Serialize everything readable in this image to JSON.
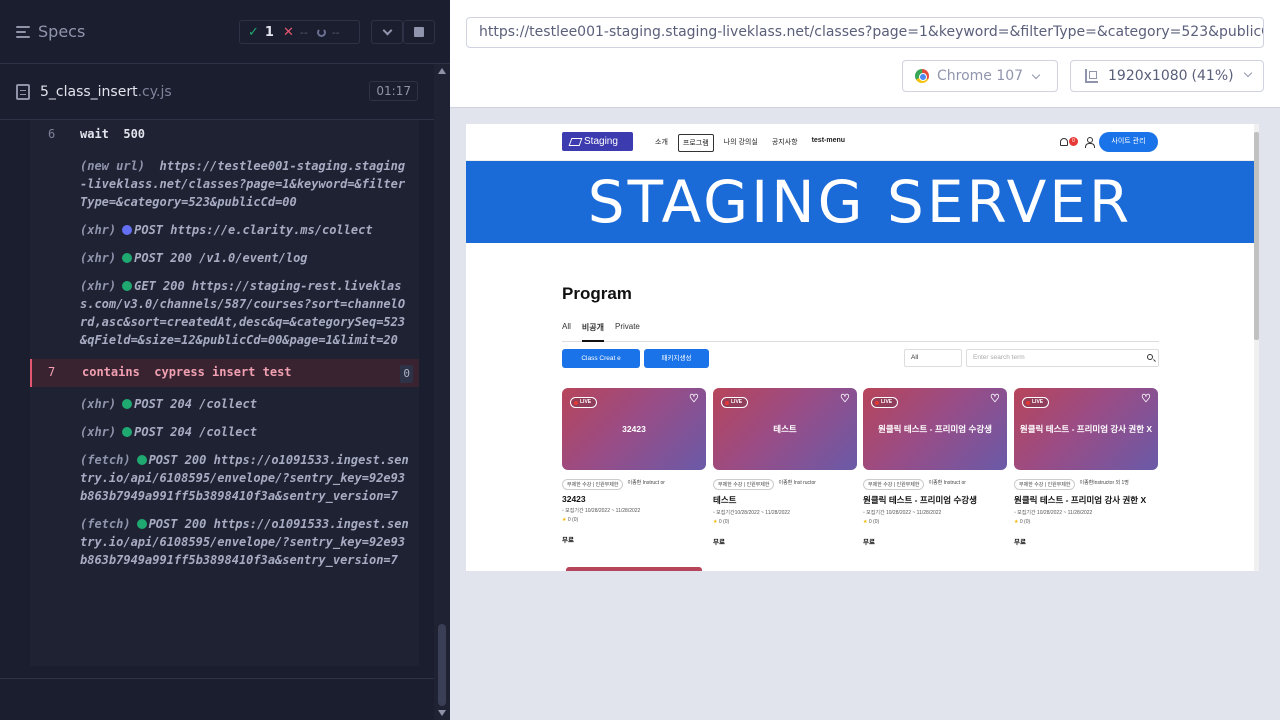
{
  "reporter": {
    "specs_label": "Specs",
    "stats": {
      "passed": "1",
      "failed": "--",
      "pending": "--"
    },
    "spec": {
      "name": "5_class_insert",
      "ext": ".cy.js",
      "duration": "01:17"
    },
    "commands": [
      {
        "no": "6",
        "name": "wait",
        "message": "500",
        "kind": "cmd"
      },
      {
        "name": "(new url)",
        "message": "https://testlee001-staging.staging-liveklass.net/classes?page=1&keyword=&filterType=&category=523&publicCd=00",
        "kind": "event"
      },
      {
        "name": "(xhr)",
        "message": "POST https://e.clarity.ms/collect",
        "kind": "xhr",
        "dot": "blue"
      },
      {
        "name": "(xhr)",
        "message": "POST 200 /v1.0/event/log",
        "kind": "xhr",
        "dot": "green"
      },
      {
        "name": "(xhr)",
        "message": "GET 200 https://staging-rest.liveklass.com/v3.0/channels/587/courses?sort=channelOrd,asc&sort=createdAt,desc&q=&categorySeq=523&qField=&size=12&publicCd=00&page=1&limit=20",
        "kind": "xhr",
        "dot": "green"
      },
      {
        "no": "7",
        "name": "contains",
        "message": "cypress insert test",
        "kind": "fail",
        "badge": "0"
      },
      {
        "name": "(xhr)",
        "message": "POST 204 /collect",
        "kind": "xhr",
        "dot": "green"
      },
      {
        "name": "(xhr)",
        "message": "POST 204 /collect",
        "kind": "xhr",
        "dot": "green"
      },
      {
        "name": "(fetch)",
        "message": "POST 200 https://o1091533.ingest.sentry.io/api/6108595/envelope/?sentry_key=92e93b863b7949a991ff5b3898410f3a&sentry_version=7",
        "kind": "xhr",
        "dot": "green"
      },
      {
        "name": "(fetch)",
        "message": "POST 200 https://o1091533.ingest.sentry.io/api/6108595/envelope/?sentry_key=92e93b863b7949a991ff5b3898410f3a&sentry_version=7",
        "kind": "xhr",
        "dot": "green"
      }
    ]
  },
  "aut": {
    "url": "https://testlee001-staging.staging-liveklass.net/classes?page=1&keyword=&filterType=&category=523&publicCd=00",
    "browser": "Chrome 107",
    "viewport": "1920x1080",
    "scale": "(41%)"
  },
  "app": {
    "logo": "Staging",
    "menu": [
      "소개",
      "프로그램",
      "나의 강의실",
      "공지사항",
      "test-menu"
    ],
    "active_menu": "프로그램",
    "notif_count": "0",
    "site_admin": "사이트 관리",
    "banner": "STAGING SERVER",
    "page_title": "Program",
    "tabs": [
      "All",
      "비공개",
      "Private"
    ],
    "active_tab": "비공개",
    "btn_create": "Class Creat e",
    "btn_package": "패키지생성",
    "filter_value": "All",
    "search_placeholder": "Enter search term",
    "cards": [
      {
        "thumb": "32423",
        "live": "LIVE",
        "meta": [
          "무제한 수강 | 인원무제한",
          "이종환 Instruct or"
        ],
        "title": "32423",
        "date": "모집기간 10/28/2022 ~ 11/28/2022",
        "rating": "0 (0)",
        "price": "무료"
      },
      {
        "thumb": "테스트",
        "live": "LIVE",
        "meta": [
          "무제한 수강 | 인원무제한",
          "이종환 Inst ructor"
        ],
        "title": "테스트",
        "date": "모집기간10/28/2022 ~ 11/28/2022",
        "rating": "0 (0)",
        "price": "무료"
      },
      {
        "thumb": "원클릭 테스트 - 프리미엄 수강생",
        "live": "LIVE",
        "meta": [
          "무제한 수강 | 인원무제한",
          "이종환 Instruct or"
        ],
        "title": "원클릭 테스트 - 프리미엄 수강생",
        "date": "모집기간 10/28/2022 ~ 11/28/2022",
        "rating": "0 (0)",
        "price": "무료"
      },
      {
        "thumb": "원클릭 테스트 - 프리미엄 강사 권한 X",
        "live": "LIVE",
        "meta": [
          "무제한 수강 | 인원무제한",
          "이종환Instructor 외 1명"
        ],
        "title": "원클릭 테스트 - 프리미엄 강사 권한 X",
        "date": "모집기간 10/28/2022 ~ 11/28/2022",
        "rating": "0 (0)",
        "price": "무료"
      }
    ]
  }
}
